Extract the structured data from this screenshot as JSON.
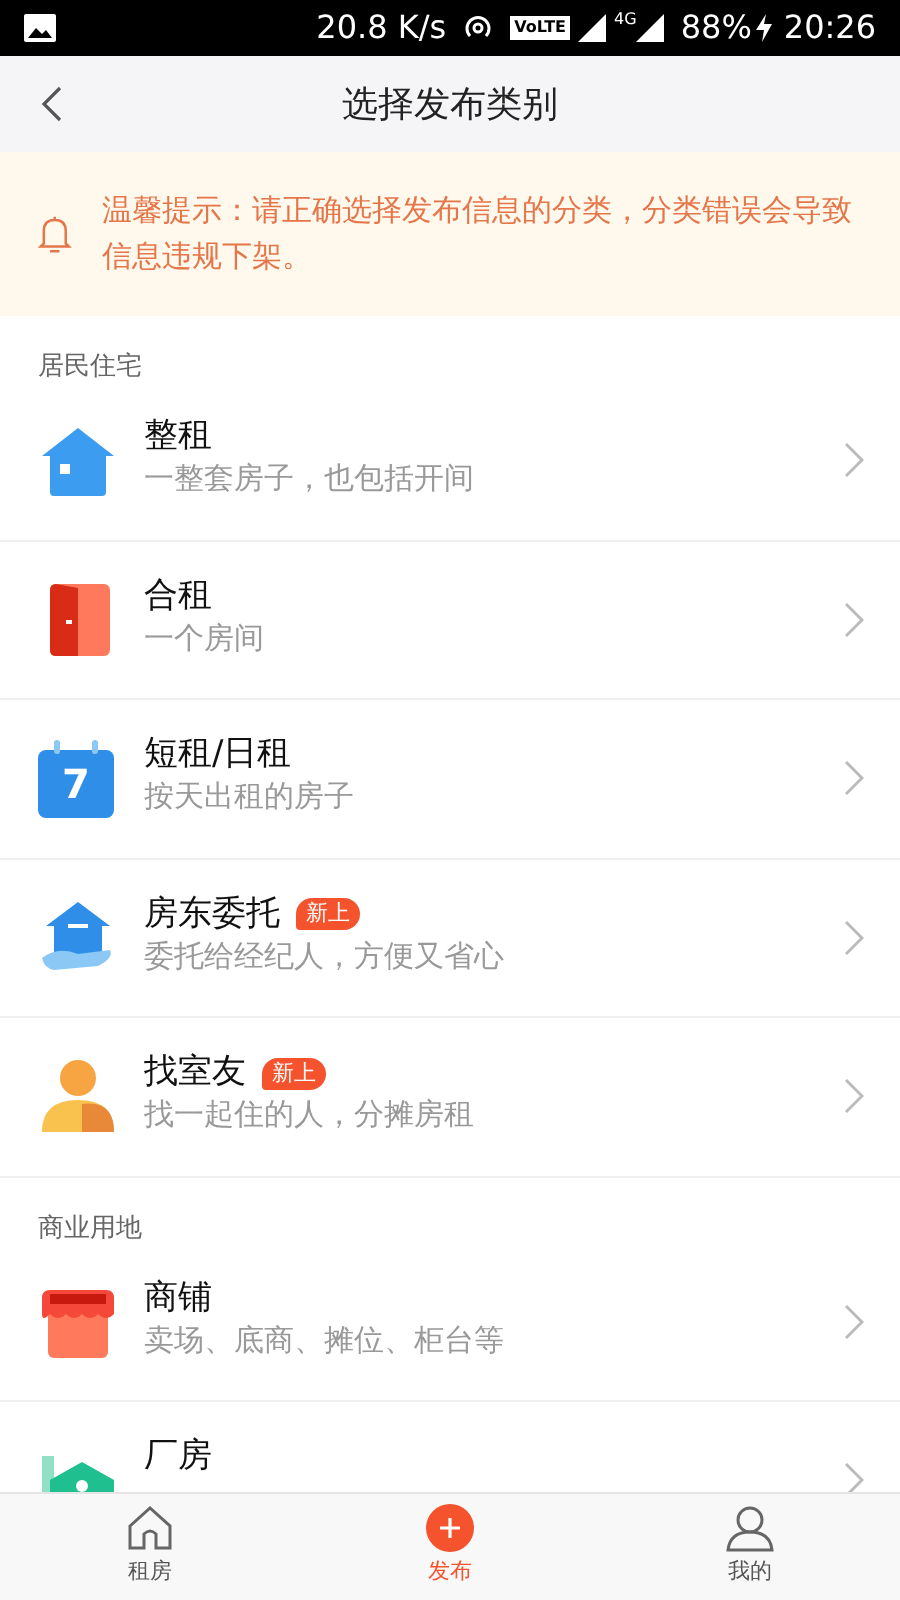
{
  "status_bar": {
    "speed": "20.8 K/s",
    "volte": "VoLTE",
    "network": "4G",
    "battery": "88%",
    "time": "20:26"
  },
  "header": {
    "title": "选择发布类别"
  },
  "notice": {
    "text": "温馨提示：请正确选择发布信息的分类，分类错误会导致信息违规下架。"
  },
  "sections": [
    {
      "label": "居民住宅",
      "items": [
        {
          "kind": "house",
          "title": "整租",
          "subtitle": "一整套房子，也包括开间"
        },
        {
          "kind": "door",
          "title": "合租",
          "subtitle": "一个房间"
        },
        {
          "kind": "calendar",
          "icon_text": "7",
          "title": "短租/日租",
          "subtitle": "按天出租的房子"
        },
        {
          "kind": "landlord",
          "title": "房东委托",
          "badge": "新上",
          "subtitle": "委托给经纪人，方便又省心"
        },
        {
          "kind": "person",
          "title": "找室友",
          "badge": "新上",
          "subtitle": "找一起住的人，分摊房租"
        }
      ]
    },
    {
      "label": "商业用地",
      "items": [
        {
          "kind": "shop",
          "title": "商铺",
          "subtitle": "卖场、底商、摊位、柜台等"
        },
        {
          "kind": "factory",
          "title": "厂房"
        }
      ]
    }
  ],
  "tab_bar": [
    {
      "kind": "home",
      "label": "租房",
      "selected": false
    },
    {
      "kind": "plus",
      "label": "发布",
      "selected": true
    },
    {
      "kind": "user",
      "label": "我的",
      "selected": false
    }
  ]
}
